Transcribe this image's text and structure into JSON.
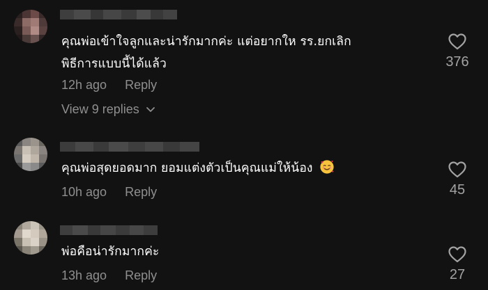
{
  "comments": [
    {
      "text_line1": "คุณพ่อเข้าใจลูกและน่ารักมากค่ะ แต่อยากให รร.ยกเลิก",
      "text_line2": "พิธีการแบบนี้ได้แล้ว",
      "time": "12h ago",
      "reply_label": "Reply",
      "view_replies": "View 9 replies",
      "likes": "376",
      "avatar_colors": [
        "#3b2a2a",
        "#6b4a48",
        "#8c6a66",
        "#2b2222"
      ]
    },
    {
      "text_line1": "คุณพ่อสุดยอดมาก ยอมแต่งตัวเป็นคุณแม่ให้น้อง",
      "emoji": "smiling-face-with-hearts",
      "time": "10h ago",
      "reply_label": "Reply",
      "likes": "45",
      "avatar_colors": [
        "#9a9a9a",
        "#c8bfb5",
        "#6a6a6a",
        "#b0a79c"
      ]
    },
    {
      "text_line1": "พ่อคือน่ารักมากค่ะ",
      "time": "13h ago",
      "reply_label": "Reply",
      "likes": "27",
      "avatar_colors": [
        "#c9c3b8",
        "#a49a8f",
        "#e0d8cc",
        "#7a7468"
      ]
    }
  ],
  "colors": {
    "background": "#121212",
    "text": "#ffffff",
    "muted": "#8f8f8f",
    "like_count": "#a3a3a3"
  }
}
